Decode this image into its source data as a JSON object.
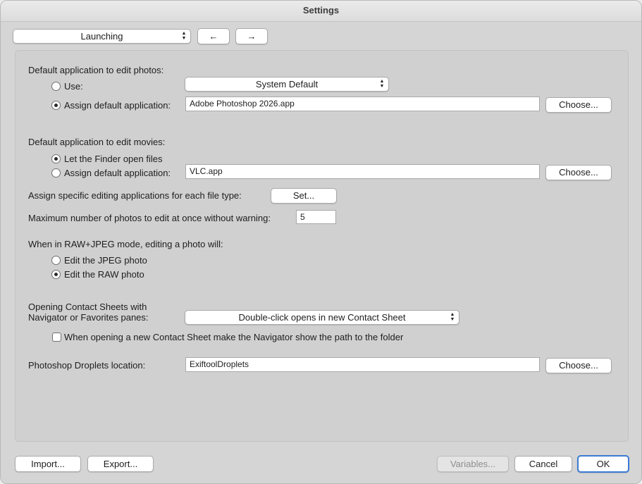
{
  "window": {
    "title": "Settings"
  },
  "toolbar": {
    "section_popup": "Launching",
    "back_label": "←",
    "forward_label": "→"
  },
  "photos": {
    "heading": "Default application to edit photos:",
    "use_label": "Use:",
    "use_popup": "System Default",
    "assign_label": "Assign default application:",
    "assign_value": "Adobe Photoshop 2026.app",
    "choose_label": "Choose...",
    "selected": "assign"
  },
  "movies": {
    "heading": "Default application to edit movies:",
    "finder_label": "Let the Finder open files",
    "assign_label": "Assign default application:",
    "assign_value": "VLC.app",
    "choose_label": "Choose...",
    "selected": "finder"
  },
  "filetype": {
    "label": "Assign specific editing applications for each file type:",
    "set_label": "Set..."
  },
  "max_photos": {
    "label": "Maximum number of photos to edit at once without warning:",
    "value": "5"
  },
  "rawjpeg": {
    "heading": "When in RAW+JPEG mode, editing a photo will:",
    "jpeg_label": "Edit the JPEG photo",
    "raw_label": "Edit the RAW photo",
    "selected": "raw"
  },
  "contact": {
    "heading_line1": "Opening Contact Sheets with",
    "heading_line2": "Navigator or Favorites panes:",
    "popup": "Double-click opens in new Contact Sheet",
    "checkbox_label": "When opening a new Contact Sheet make the Navigator show the path to the folder",
    "checkbox_checked": false
  },
  "droplets": {
    "label": "Photoshop Droplets location:",
    "value": "ExiftoolDroplets",
    "choose_label": "Choose..."
  },
  "footer": {
    "import_label": "Import...",
    "export_label": "Export...",
    "variables_label": "Variables...",
    "cancel_label": "Cancel",
    "ok_label": "OK"
  },
  "colors": {
    "accent": "#3a7bd5",
    "window_bg": "#d5d5d5"
  }
}
